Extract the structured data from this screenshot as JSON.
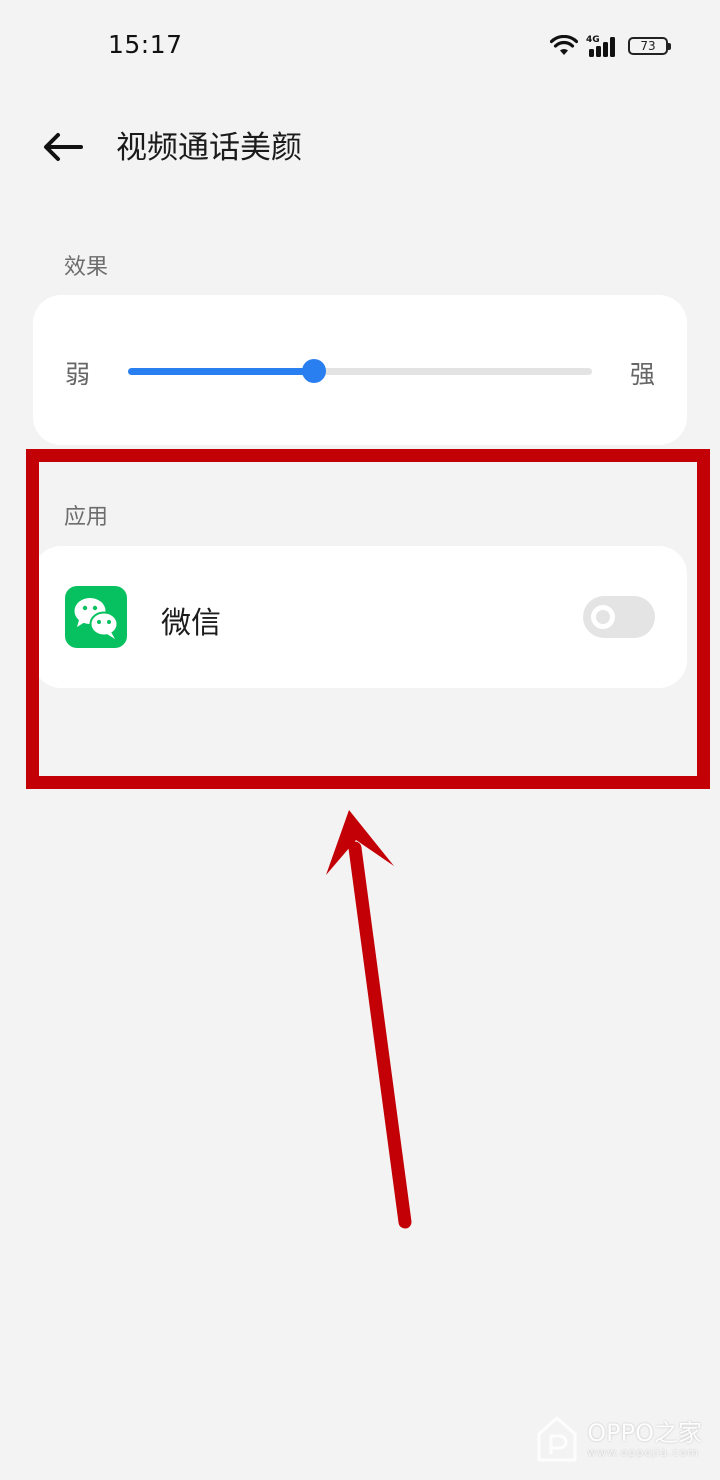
{
  "status_bar": {
    "time": "15:17",
    "network": "4G",
    "battery": "73"
  },
  "header": {
    "title": "视频通话美颜",
    "back_icon": "arrow-left-icon"
  },
  "effect_section": {
    "label": "效果",
    "slider": {
      "min_label": "弱",
      "max_label": "强",
      "value_fraction": 0.4
    }
  },
  "apps_section": {
    "label": "应用",
    "items": [
      {
        "name": "微信",
        "icon": "wechat-icon",
        "enabled": false
      }
    ]
  },
  "annotation": {
    "color": "#c30006"
  },
  "colors": {
    "accent": "#2a7ff0",
    "background": "#f4f3f4",
    "card": "#ffffff",
    "wechat_green": "#07c160"
  },
  "watermark": {
    "title": "OPPO之家",
    "url": "www.oppojia.com"
  }
}
